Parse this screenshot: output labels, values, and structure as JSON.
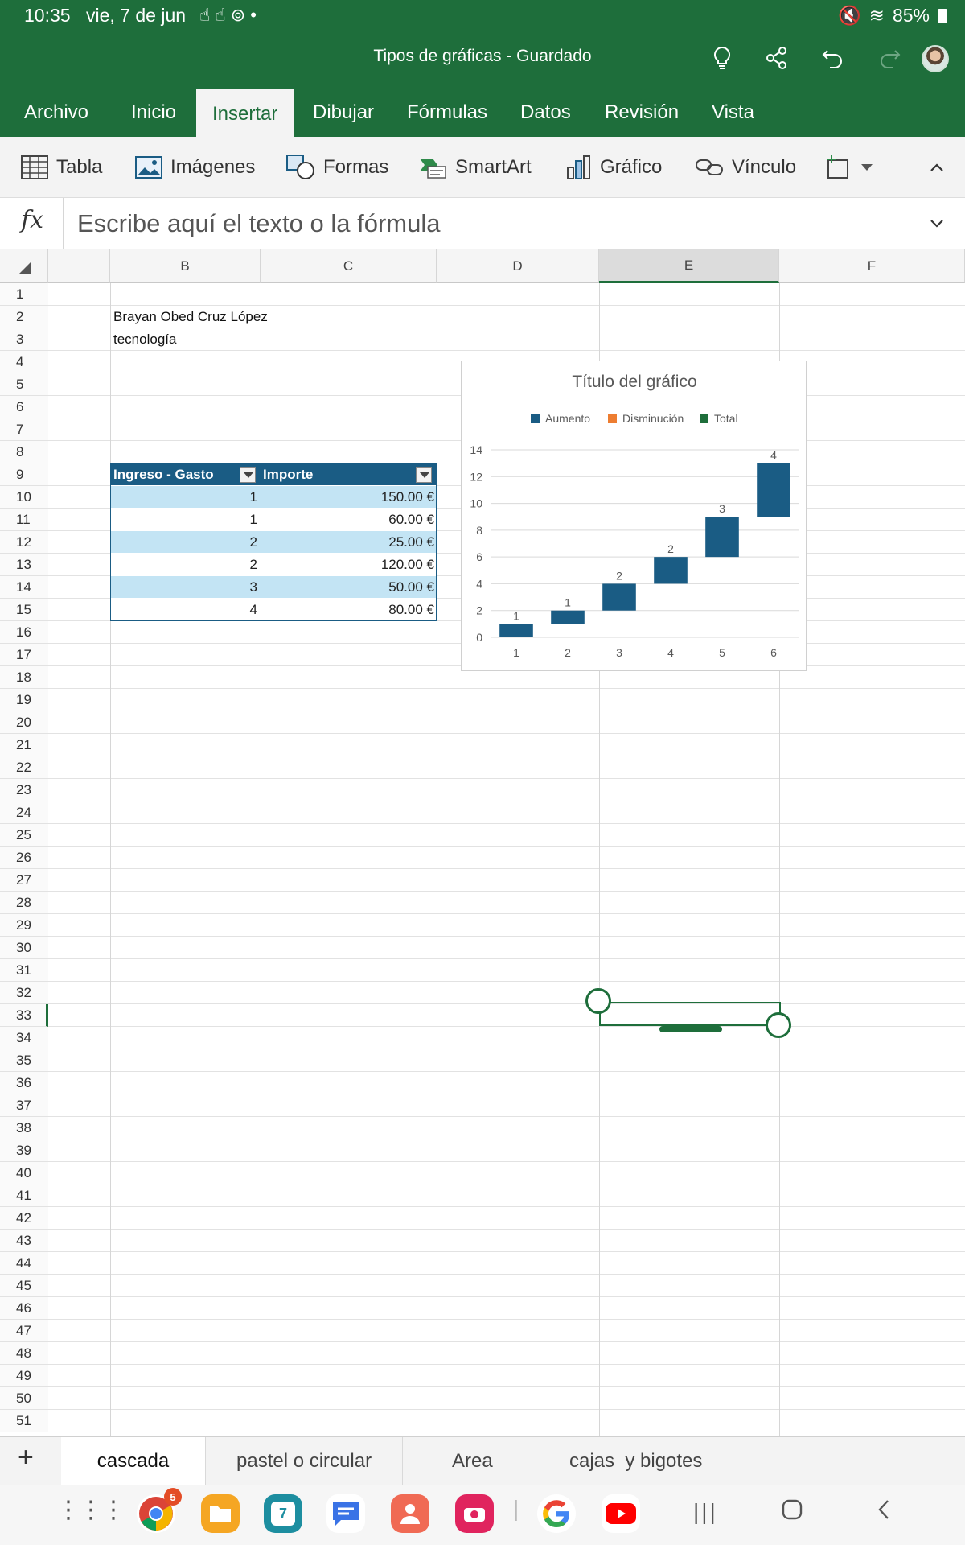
{
  "status": {
    "time": "10:35",
    "date": "vie, 7 de jun",
    "battery": "85%"
  },
  "title_bar": {
    "document_title": "Tipos de gráficas - Guardado",
    "icons": [
      "lightbulb-icon",
      "share-icon",
      "undo-icon",
      "redo-icon",
      "avatar"
    ]
  },
  "tabs": [
    "Archivo",
    "Inicio",
    "Insertar",
    "Dibujar",
    "Fórmulas",
    "Datos",
    "Revisión",
    "Vista"
  ],
  "active_tab": "Insertar",
  "ribbon": {
    "table": "Tabla",
    "images": "Imágenes",
    "shapes": "Formas",
    "smartart": "SmartArt",
    "chart": "Gráfico",
    "link": "Vínculo"
  },
  "formula_bar": {
    "fx": "fx",
    "placeholder": "Escribe aquí el texto o la fórmula"
  },
  "columns": [
    "B",
    "C",
    "D",
    "E",
    "F"
  ],
  "rows": [
    "1",
    "2",
    "3",
    "4",
    "5",
    "6",
    "7",
    "8",
    "9",
    "10",
    "11",
    "12",
    "13",
    "14",
    "15",
    "16",
    "17",
    "18",
    "19",
    "20",
    "21",
    "22",
    "23",
    "24",
    "25",
    "26",
    "27",
    "28",
    "29",
    "30",
    "31",
    "32",
    "33",
    "34",
    "35",
    "36",
    "37",
    "38",
    "39",
    "40",
    "41",
    "42",
    "43",
    "44",
    "45",
    "46",
    "47",
    "48",
    "49",
    "50",
    "51"
  ],
  "selected_column": "E",
  "selected_row": "33",
  "cells": {
    "b2": "Brayan Obed Cruz López",
    "b3": "tecnología"
  },
  "table": {
    "headers": [
      "Ingreso - Gasto",
      "Importe"
    ],
    "rows": [
      [
        "1",
        "150.00 €"
      ],
      [
        "1",
        "60.00 €"
      ],
      [
        "2",
        "25.00 €"
      ],
      [
        "2",
        "120.00 €"
      ],
      [
        "3",
        "50.00 €"
      ],
      [
        "4",
        "80.00 €"
      ]
    ]
  },
  "chart_data": {
    "type": "waterfall",
    "title": "Título del gráfico",
    "legend": [
      "Aumento",
      "Disminución",
      "Total"
    ],
    "legend_colors": [
      "#1a5c84",
      "#ed7d31",
      "#1e6e3b"
    ],
    "legend_position": "top",
    "categories": [
      "1",
      "2",
      "3",
      "4",
      "5",
      "6"
    ],
    "values": [
      1,
      1,
      2,
      2,
      3,
      4
    ],
    "ylim": [
      0,
      14
    ],
    "yticks": [
      "0",
      "2",
      "4",
      "6",
      "8",
      "10",
      "12",
      "14"
    ],
    "grid": true,
    "bar_color": "#1a5c84"
  },
  "sheets": [
    "cascada",
    "pastel o circular",
    "Area",
    "cajas  y bigotes"
  ],
  "active_sheet": "cascada",
  "nav": {
    "chrome_badge": "5",
    "calendar_day": "7"
  }
}
